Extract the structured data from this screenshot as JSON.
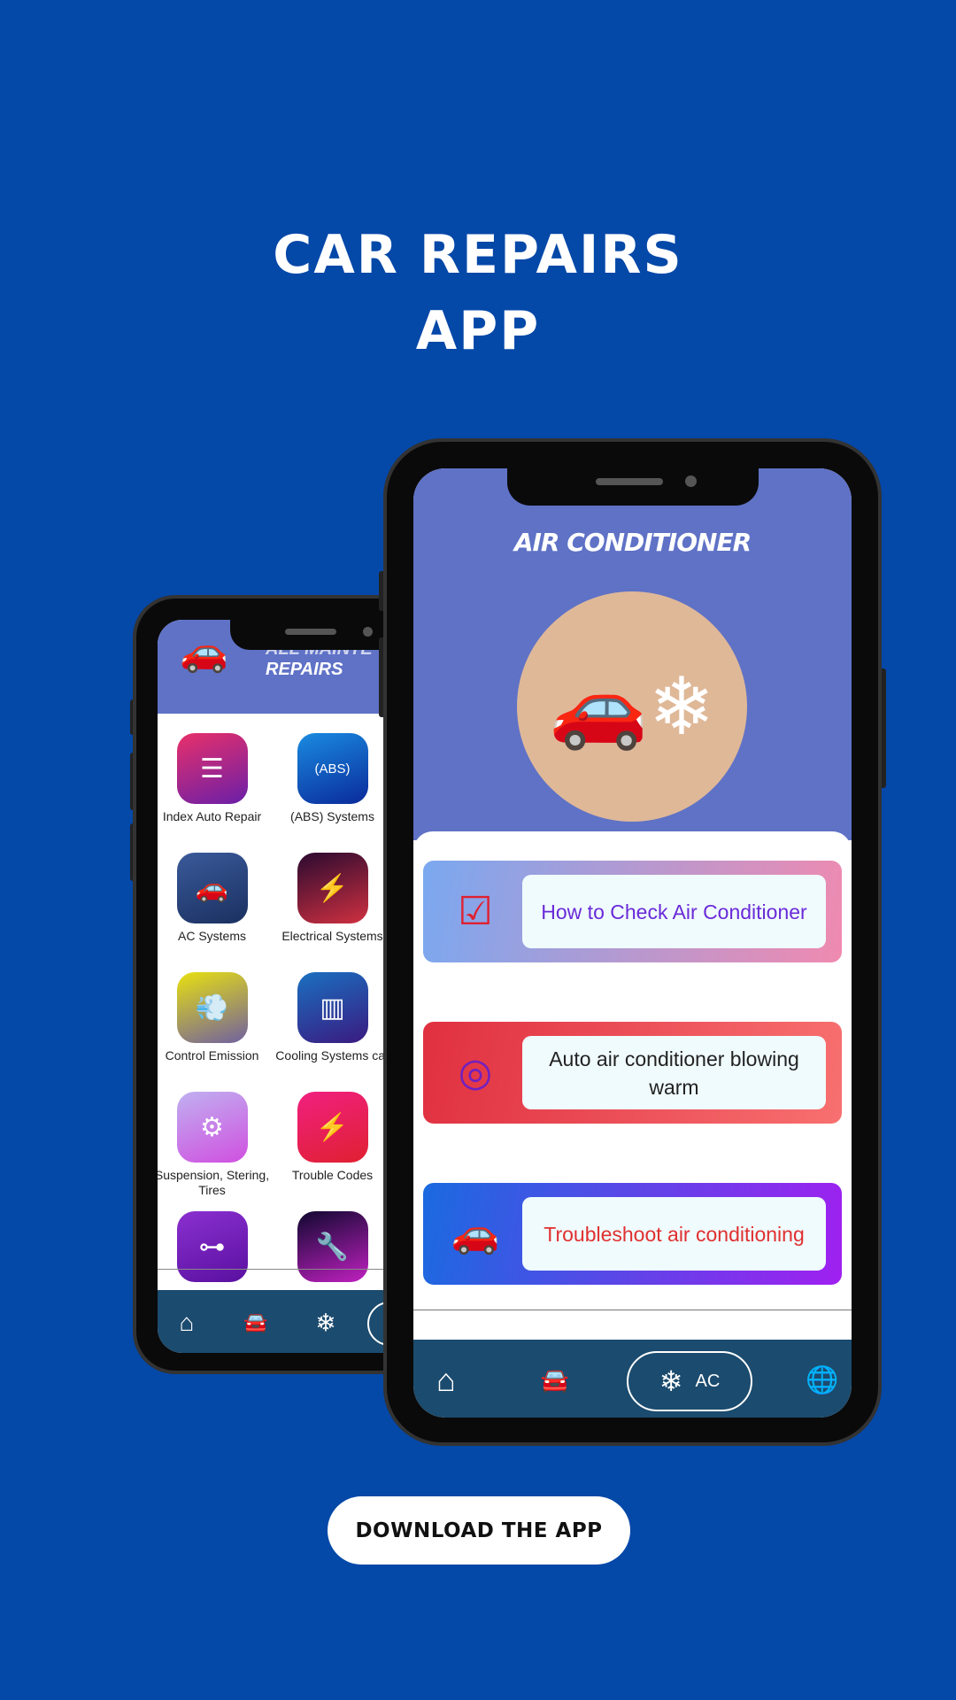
{
  "headline": {
    "line1": "CAR REPAIRS",
    "line2": "APP"
  },
  "back_phone": {
    "header_title": {
      "line1": "ALL MAINTE",
      "line2": "REPAIRS"
    },
    "tiles": [
      {
        "label": "Index Auto Repair",
        "icon": "list-icon",
        "colors": [
          "#e8306a",
          "#6a1fa8"
        ]
      },
      {
        "label": "(ABS) Systems",
        "icon": "abs-icon",
        "colors": [
          "#1a8be0",
          "#0a2a9a"
        ]
      },
      {
        "label": "AC Systems",
        "icon": "car-snow-icon",
        "colors": [
          "#3a5a9a",
          "#1a3060"
        ]
      },
      {
        "label": "Electrical Systems",
        "icon": "electric-car-icon",
        "colors": [
          "#2a0a30",
          "#d03040"
        ]
      },
      {
        "label": "Control Emission",
        "icon": "exhaust-icon",
        "colors": [
          "#e8e010",
          "#7060a0"
        ]
      },
      {
        "label": "Cooling Systems car",
        "icon": "radiator-icon",
        "colors": [
          "#1a70c0",
          "#3a1a80"
        ]
      },
      {
        "label": "Suspension, Stering, Tires",
        "icon": "suspension-icon",
        "colors": [
          "#c0b0f0",
          "#d050e0"
        ]
      },
      {
        "label": "Trouble Codes",
        "icon": "engine-icon",
        "colors": [
          "#f02080",
          "#e02030"
        ]
      },
      {
        "label": "",
        "icon": "axle-icon",
        "colors": [
          "#8a30d0",
          "#5a10a0"
        ]
      },
      {
        "label": "",
        "icon": "wrench-icon",
        "colors": [
          "#100830",
          "#c020c0"
        ]
      }
    ],
    "nav": [
      "home-icon",
      "car-icon",
      "snowflake-icon"
    ]
  },
  "front_phone": {
    "header_title": "AIR CONDITIONER",
    "hero_color": "#dfb898",
    "header_color": "#5f72c6",
    "cards": [
      {
        "text": "How to Check Air Conditioner",
        "text_color": "#6a2ad8",
        "icon": "check-car-snow-icon",
        "gradient": [
          "#7aa8f0",
          "#f08ab0"
        ]
      },
      {
        "text": "Auto air conditioner blowing warm",
        "text_color": "#222222",
        "icon": "blower-icon",
        "gradient": [
          "#e03040",
          "#f87070"
        ]
      },
      {
        "text": "Troubleshoot air conditioning",
        "text_color": "#e03030",
        "icon": "car-diagnostic-icon",
        "gradient": [
          "#1a6ae0",
          "#a020f0"
        ]
      }
    ],
    "nav": {
      "home": "home-icon",
      "car": "car-icon",
      "ac_label": "AC",
      "ac_icon": "snowflake-icon",
      "globe": "globe-icon"
    }
  },
  "download_button": "DOWNLOAD THE APP"
}
